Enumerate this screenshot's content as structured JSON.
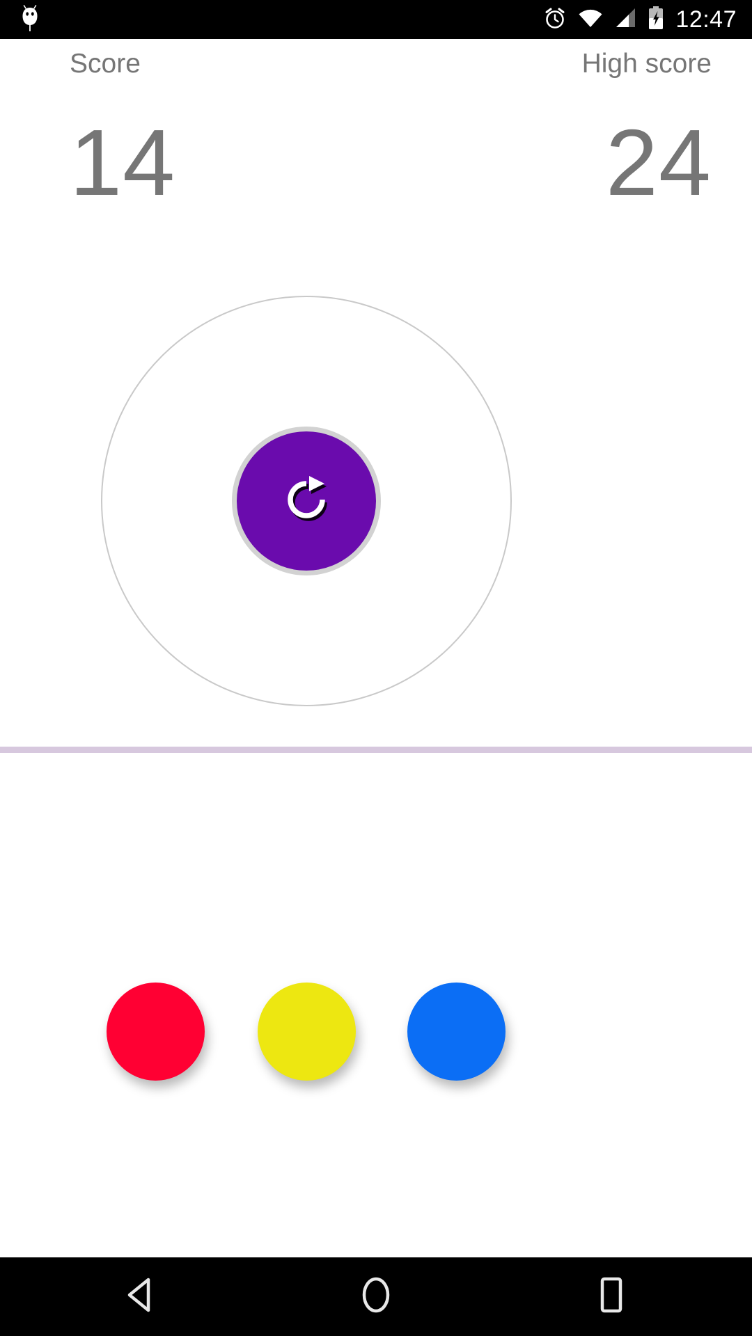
{
  "status_bar": {
    "background": "#000000",
    "time": "12:47",
    "left_icons": [
      {
        "name": "android-bugdroid-icon",
        "label": "Android"
      }
    ],
    "right_icons": [
      {
        "name": "alarm-clock-icon",
        "label": "Alarm set"
      },
      {
        "name": "wifi-icon",
        "label": "Wi-Fi connected"
      },
      {
        "name": "cellular-signal-icon",
        "label": "Cellular signal"
      },
      {
        "name": "battery-charging-icon",
        "label": "Battery charging"
      }
    ]
  },
  "scoreboard": {
    "score": {
      "label": "Score",
      "value": "14"
    },
    "high_score": {
      "label": "High score",
      "value": "24"
    },
    "text_color": "#767676"
  },
  "playfield": {
    "outer_ring": {
      "name": "target-ring",
      "stroke": "#c9c9c9"
    },
    "center_button": {
      "name": "restart-button",
      "icon": "refresh-icon",
      "fill": "#6A0BAD",
      "border": "#d2d2d2"
    }
  },
  "divider": {
    "color": "#d7c8de"
  },
  "palette": {
    "label": "Color choices",
    "dots": [
      {
        "name": "color-dot-red",
        "color_name": "red",
        "color": "#FF0033"
      },
      {
        "name": "color-dot-yellow",
        "color_name": "yellow",
        "color": "#EDE711"
      },
      {
        "name": "color-dot-blue",
        "color_name": "blue",
        "color": "#0B6EF5"
      }
    ]
  },
  "nav_bar": {
    "background": "#000000",
    "buttons": [
      {
        "name": "nav-back-button",
        "label": "Back"
      },
      {
        "name": "nav-home-button",
        "label": "Home"
      },
      {
        "name": "nav-recents-button",
        "label": "Recents"
      }
    ]
  }
}
